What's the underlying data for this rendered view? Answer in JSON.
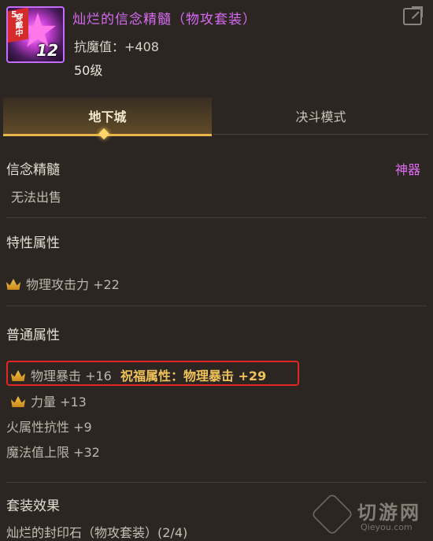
{
  "item": {
    "name": "灿烂的信念精髓（物攻套装）",
    "stat": "抗魔值：+408",
    "level": "50级",
    "icon_tag": "穿戴中",
    "icon_corner": "5",
    "icon_level": "12"
  },
  "tabs": [
    {
      "label": "地下城",
      "active": true
    },
    {
      "label": "决斗模式",
      "active": false
    }
  ],
  "info": {
    "type_name": "信念精髓",
    "rarity": "神器",
    "trade": "无法出售"
  },
  "special": {
    "title": "特性属性",
    "lines": [
      "物理攻击力 +22"
    ]
  },
  "normal": {
    "title": "普通属性",
    "line1_main": "物理暴击 +16",
    "line1_bless": "祝福属性：物理暴击 +29",
    "line2": "力量 +13",
    "line3": "火属性抗性 +9",
    "line4": "魔法值上限 +32"
  },
  "set": {
    "title": "套装效果",
    "item": "灿烂的封印石（物攻套装）(2/4)"
  },
  "watermark": {
    "text": "切游网",
    "sub": "Qieyou.com"
  },
  "colors": {
    "background": "#2b2622",
    "title_purple": "#d86bf3",
    "rarity": "#e16cf5",
    "tab_gold": "#e8b64a",
    "highlight_red": "#e02626"
  },
  "icons": [
    "share-icon",
    "crown-icon",
    "item-icon"
  ]
}
